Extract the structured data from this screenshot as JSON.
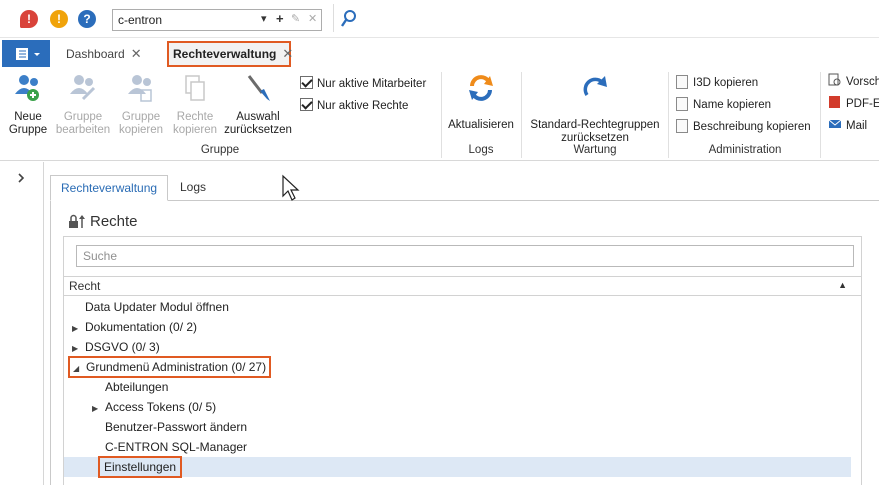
{
  "quick_access": {
    "combo_value": "c-entron",
    "combo_buttons": [
      "▾",
      "+",
      "✎",
      "✕"
    ]
  },
  "tabs": [
    {
      "label": "Dashboard",
      "close": "✕"
    },
    {
      "label": "Rechteverwaltung",
      "close": "✕"
    }
  ],
  "ribbon": {
    "groups": {
      "gruppe": {
        "label": "Gruppe",
        "buttons": [
          {
            "line1": "Neue",
            "line2": "Gruppe",
            "enabled": true
          },
          {
            "line1": "Gruppe",
            "line2": "bearbeiten",
            "enabled": false
          },
          {
            "line1": "Gruppe",
            "line2": "kopieren",
            "enabled": false
          },
          {
            "line1": "Rechte",
            "line2": "kopieren",
            "enabled": false
          },
          {
            "line1": "Auswahl",
            "line2": "zurücksetzen",
            "enabled": true
          }
        ],
        "checkboxes": [
          {
            "label": "Nur aktive Mitarbeiter",
            "checked": true
          },
          {
            "label": "Nur aktive Rechte",
            "checked": true
          }
        ]
      },
      "logs": {
        "label": "Logs",
        "button": "Aktualisieren"
      },
      "wartung": {
        "label": "Wartung",
        "line1": "Standard-Rechtegruppen",
        "line2": "zurücksetzen"
      },
      "administration": {
        "label": "Administration",
        "buttons": [
          "I3D kopieren",
          "Name kopieren",
          "Beschreibung kopieren"
        ]
      },
      "extra": {
        "buttons": [
          "Vorsch",
          "PDF-E",
          "Mail"
        ]
      }
    }
  },
  "content": {
    "inner_tabs": [
      "Rechteverwaltung",
      "Logs"
    ],
    "section_title": "Rechte",
    "search_placeholder": "Suche",
    "column_header": "Recht",
    "sort_indicator": "▲",
    "rows": [
      {
        "text": "Data Updater Modul öffnen",
        "expander": ""
      },
      {
        "text": "Dokumentation (0/ 2)",
        "expander": "▶"
      },
      {
        "text": "DSGVO (0/ 3)",
        "expander": "▶"
      },
      {
        "text": "Grundmenü Administration (0/ 27)",
        "expander": "◢"
      },
      {
        "text": "Abteilungen",
        "expander": ""
      },
      {
        "text": "Access Tokens (0/ 5)",
        "expander": "▶"
      },
      {
        "text": "Benutzer-Passwort ändern",
        "expander": ""
      },
      {
        "text": "C-ENTRON SQL-Manager",
        "expander": ""
      },
      {
        "text": "Einstellungen",
        "expander": ""
      }
    ]
  },
  "colors": {
    "accent": "#2b6dbb",
    "highlight_box": "#e05a22",
    "selected_row": "#dde8f5"
  }
}
